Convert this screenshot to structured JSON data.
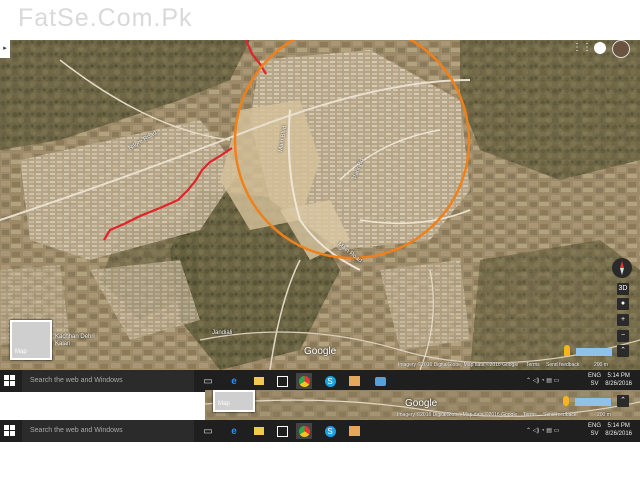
{
  "watermark": "FatSe.Com.Pk",
  "map": {
    "google_logo": "Google",
    "attribution": "Imagery ©2016 DigitalGlobe, Map data ©2016 Google",
    "terms": "Terms",
    "send_feedback": "Send feedback",
    "scale": "200 m",
    "map_toggle_label": "Map",
    "tilt_label": "3D",
    "zoom_in": "+",
    "zoom_out": "−",
    "compass_icon": "compass-icon",
    "place_labels": [
      "Jandiali",
      "Kachhan Dehri Kalan"
    ],
    "road_labels": [
      "Nilore Road",
      "Main Blvd",
      "Park Rd",
      "Main Road"
    ],
    "circle_color": "#f0801a",
    "route_color": "#e0242a"
  },
  "taskbar": {
    "search_placeholder": "Search the web and Windows",
    "lang_line1": "ENG",
    "lang_line2": "SV",
    "time": "5:14 PM",
    "date": "8/26/2016",
    "icons": [
      "task-view-icon",
      "edge-icon",
      "file-explorer-icon",
      "store-icon",
      "chrome-icon",
      "skype-icon",
      "media-player-icon",
      "photos-icon"
    ]
  },
  "taskbar2": {
    "search_placeholder": "Search the web and Windows",
    "lang_line1": "ENG",
    "lang_line2": "SV",
    "time": "5:14 PM",
    "date": "8/26/2016"
  },
  "map2": {
    "google_logo": "Google",
    "attribution": "Imagery ©2016 DigitalGlobe, Map data ©2016 Google",
    "terms": "Terms",
    "send_feedback": "Send feedback",
    "scale": "200 m",
    "map_toggle_label": "Map"
  }
}
